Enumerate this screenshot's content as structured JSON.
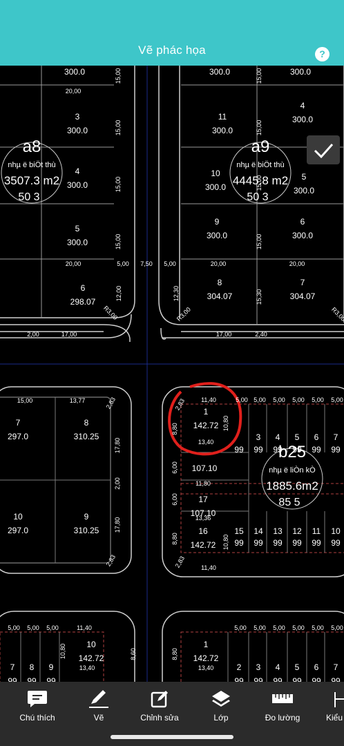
{
  "header": {
    "title": "Vẽ phác họa",
    "help_label": "?"
  },
  "map": {
    "lots": [
      {
        "id": "a8",
        "type": "nhµ ë biÖt thù",
        "area": "3507.3 m2",
        "extra": "50 3"
      },
      {
        "id": "a9",
        "type": "nhµ ë biÖt thù",
        "area": "4445.8 m2",
        "extra": "50 3"
      },
      {
        "id": "b25",
        "type": "nhµ ë liÒn kÒ",
        "area": "1885.6m2",
        "extra": "85 5"
      }
    ],
    "plots_a8": [
      {
        "n": "",
        "a": "300.0"
      },
      {
        "n": "3",
        "a": "300.0"
      },
      {
        "n": "4",
        "a": "300.0"
      },
      {
        "n": "5",
        "a": "300.0"
      },
      {
        "n": "6",
        "a": "298.07"
      }
    ],
    "plots_a9": [
      {
        "n": "",
        "a": "300.0"
      },
      {
        "n": "",
        "a": "300.0"
      },
      {
        "n": "11",
        "a": "300.0"
      },
      {
        "n": "4",
        "a": "300.0"
      },
      {
        "n": "10",
        "a": "300.0"
      },
      {
        "n": "5",
        "a": "300.0"
      },
      {
        "n": "9",
        "a": "300.0"
      },
      {
        "n": "6",
        "a": "300.0"
      },
      {
        "n": "8",
        "a": "304.07"
      },
      {
        "n": "7",
        "a": "304.07"
      }
    ],
    "plots_mid_left": [
      {
        "n": "7",
        "a": "297.0"
      },
      {
        "n": "8",
        "a": "310.25"
      },
      {
        "n": "10",
        "a": "297.0"
      },
      {
        "n": "9",
        "a": "310.25"
      }
    ],
    "plots_b25": [
      {
        "n": "1",
        "a": "142.72"
      },
      {
        "n": "",
        "a": "107.10"
      },
      {
        "n": "17",
        "a": "107.10"
      },
      {
        "n": "16",
        "a": "142.72"
      }
    ],
    "b25_row_top": [
      "3",
      "4",
      "5",
      "6",
      "7"
    ],
    "b25_row_top_vals": [
      "99",
      "99",
      "99",
      "99",
      "99"
    ],
    "b25_row_bottom": [
      "15",
      "14",
      "13",
      "12",
      "11",
      "10"
    ],
    "b25_row_bottom_vals": [
      "99",
      "99",
      "99",
      "99",
      "99",
      "99"
    ],
    "dims": {
      "d20": "20,00",
      "d15": "15,00",
      "d5": "5,00",
      "d750": "7,50",
      "d12": "12,00",
      "d1230": "12,30",
      "d1530": "15,30",
      "d200": "2,00",
      "d17": "17,00",
      "d240": "2,40",
      "d1377": "13,77",
      "d283": "2,83",
      "d1780": "17,80",
      "d1140": "11,40",
      "d1080": "10,80",
      "d1340": "13,40",
      "d880": "8,80",
      "d600": "6,00",
      "d1180": "11,80",
      "d1336": "13,36",
      "d860": "8,60",
      "r30": "R3,00"
    },
    "bottom_plots_left": [
      {
        "n": "10",
        "a": "142.72"
      },
      {
        "n": "7",
        "a": "99"
      },
      {
        "n": "8",
        "a": "99"
      },
      {
        "n": "9",
        "a": "99"
      }
    ],
    "bottom_plots_right": [
      {
        "n": "1",
        "a": "142.72"
      },
      {
        "n": "2",
        "a": "99"
      },
      {
        "n": "3",
        "a": "99"
      },
      {
        "n": "4",
        "a": "99"
      },
      {
        "n": "5",
        "a": "99"
      },
      {
        "n": "6",
        "a": "99"
      },
      {
        "n": "7",
        "a": "99"
      }
    ]
  },
  "toolbar": {
    "items": [
      {
        "label": "Chú thích",
        "icon": "annotation-icon"
      },
      {
        "label": "Vẽ",
        "icon": "pencil-icon"
      },
      {
        "label": "Chỉnh sửa",
        "icon": "edit-icon"
      },
      {
        "label": "Lớp",
        "icon": "layers-icon"
      },
      {
        "label": "Đo lường",
        "icon": "ruler-icon"
      },
      {
        "label": "Kiểu",
        "icon": "style-icon"
      }
    ]
  },
  "colors": {
    "header": "#3ec6c9",
    "highlight": "#e0201c",
    "toolbar": "#2b2b2b"
  }
}
